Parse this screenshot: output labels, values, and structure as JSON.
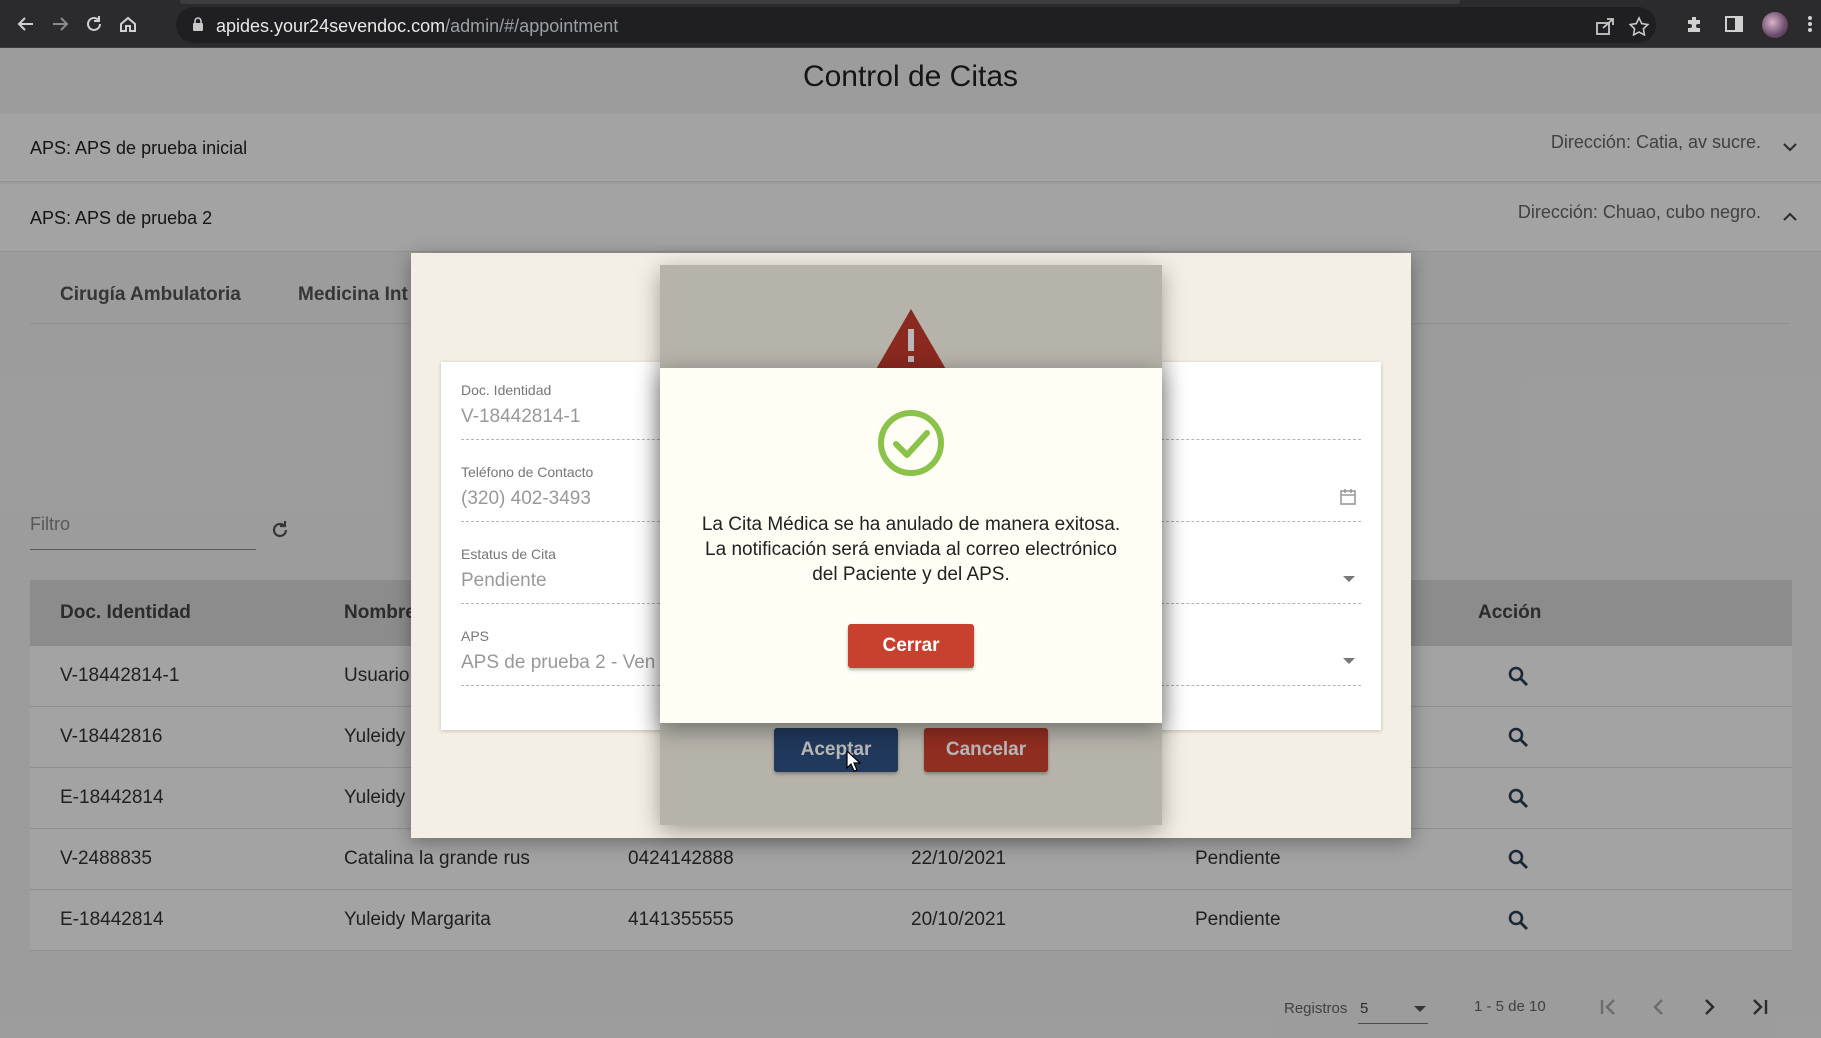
{
  "browser": {
    "url_host": "apides.your24sevendoc.com",
    "url_path": "/admin/#/appointment",
    "icons": [
      "back-icon",
      "forward-icon",
      "reload-icon",
      "home-icon",
      "lock-icon",
      "share-icon",
      "star-icon",
      "extensions-icon",
      "sidepanel-icon",
      "profile-avatar",
      "menu-icon"
    ]
  },
  "page": {
    "title": "Control de Citas"
  },
  "panels": [
    {
      "label": "APS: APS de prueba inicial",
      "direccion": "Dirección: Catia, av sucre.",
      "expanded": false
    },
    {
      "label": "APS: APS de prueba 2",
      "direccion": "Dirección: Chuao, cubo negro.",
      "expanded": true
    }
  ],
  "tabs": [
    "Cirugía Ambulatoria",
    "Medicina Int"
  ],
  "filter": {
    "placeholder": "Filtro"
  },
  "table": {
    "headers": [
      "Doc. Identidad",
      "Nombre",
      "Acción"
    ],
    "rows": [
      {
        "doc": "V-18442814-1",
        "nombre": "Usuario",
        "telefono": "",
        "fecha": "",
        "estatus": ""
      },
      {
        "doc": "V-18442816",
        "nombre": "Yuleidy",
        "telefono": "",
        "fecha": "",
        "estatus": ""
      },
      {
        "doc": "E-18442814",
        "nombre": "Yuleidy",
        "telefono": "",
        "fecha": "",
        "estatus": ""
      },
      {
        "doc": "V-2488835",
        "nombre": "Catalina la grande rus",
        "telefono": "0424142888",
        "fecha": "22/10/2021",
        "estatus": "Pendiente"
      },
      {
        "doc": "E-18442814",
        "nombre": "Yuleidy Margarita",
        "telefono": "4141355555",
        "fecha": "20/10/2021",
        "estatus": "Pendiente"
      }
    ]
  },
  "paginator": {
    "label": "Registros",
    "page_size": "5",
    "range": "1 - 5 de 10"
  },
  "edit_dialog": {
    "fields": [
      {
        "label": "Doc. Identidad",
        "value": "V-18442814-1"
      },
      {
        "label": "Teléfono de Contacto",
        "value": "(320) 402-3493"
      },
      {
        "label": "Estatus de Cita",
        "value": "Pendiente"
      },
      {
        "label": "APS",
        "value": "APS de prueba 2 - Ven"
      }
    ]
  },
  "confirm_dialog": {
    "accept_label": "Aceptar",
    "cancel_label": "Cancelar"
  },
  "success_dialog": {
    "message_line1": "La Cita Médica se ha anulado de manera exitosa.",
    "message_line2": "La notificación será enviada al correo electrónico",
    "message_line3": "del Paciente y del APS.",
    "close_label": "Cerrar"
  },
  "colors": {
    "primary_blue": "#2f4f80",
    "danger_red": "#c8402e",
    "warning_red": "#c0392b",
    "success_green": "#8bc34a"
  }
}
